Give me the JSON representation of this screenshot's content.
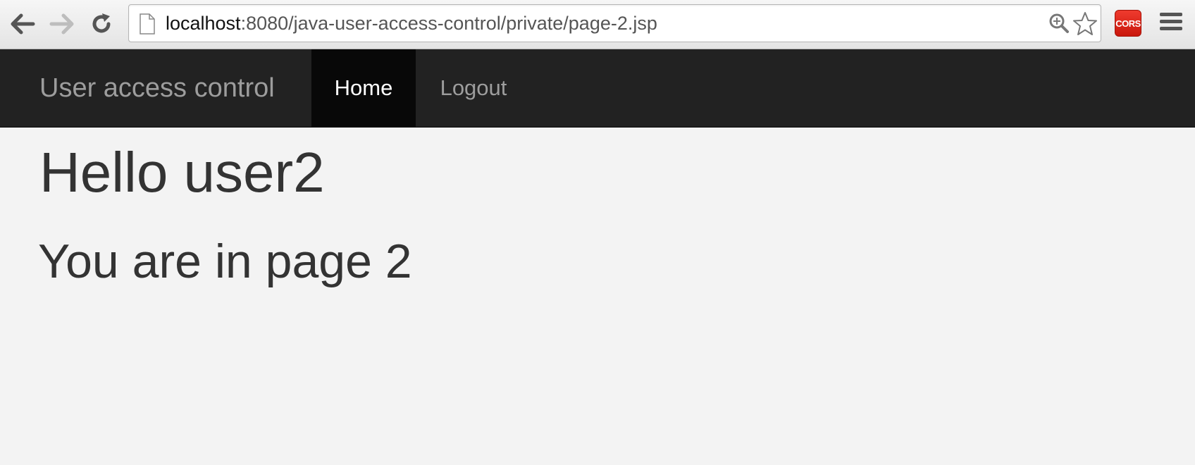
{
  "browser": {
    "url_host": "localhost",
    "url_path": ":8080/java-user-access-control/private/page-2.jsp",
    "extension_label": "CORS",
    "icons": {
      "back": "back-arrow-icon",
      "forward": "forward-arrow-icon",
      "reload": "reload-icon",
      "page": "page-icon",
      "zoom": "zoom-icon",
      "bookmark": "star-icon",
      "menu": "hamburger-menu-icon"
    }
  },
  "navbar": {
    "brand": "User access control",
    "items": [
      {
        "label": "Home",
        "active": true
      },
      {
        "label": "Logout",
        "active": false
      }
    ]
  },
  "main": {
    "greeting": "Hello user2",
    "heading": "You are in page 2"
  },
  "colors": {
    "navbar_bg": "#222222",
    "active_item_bg": "#080808",
    "page_bg": "#f3f3f3",
    "text": "#333333",
    "cors_red": "#d9261c"
  }
}
